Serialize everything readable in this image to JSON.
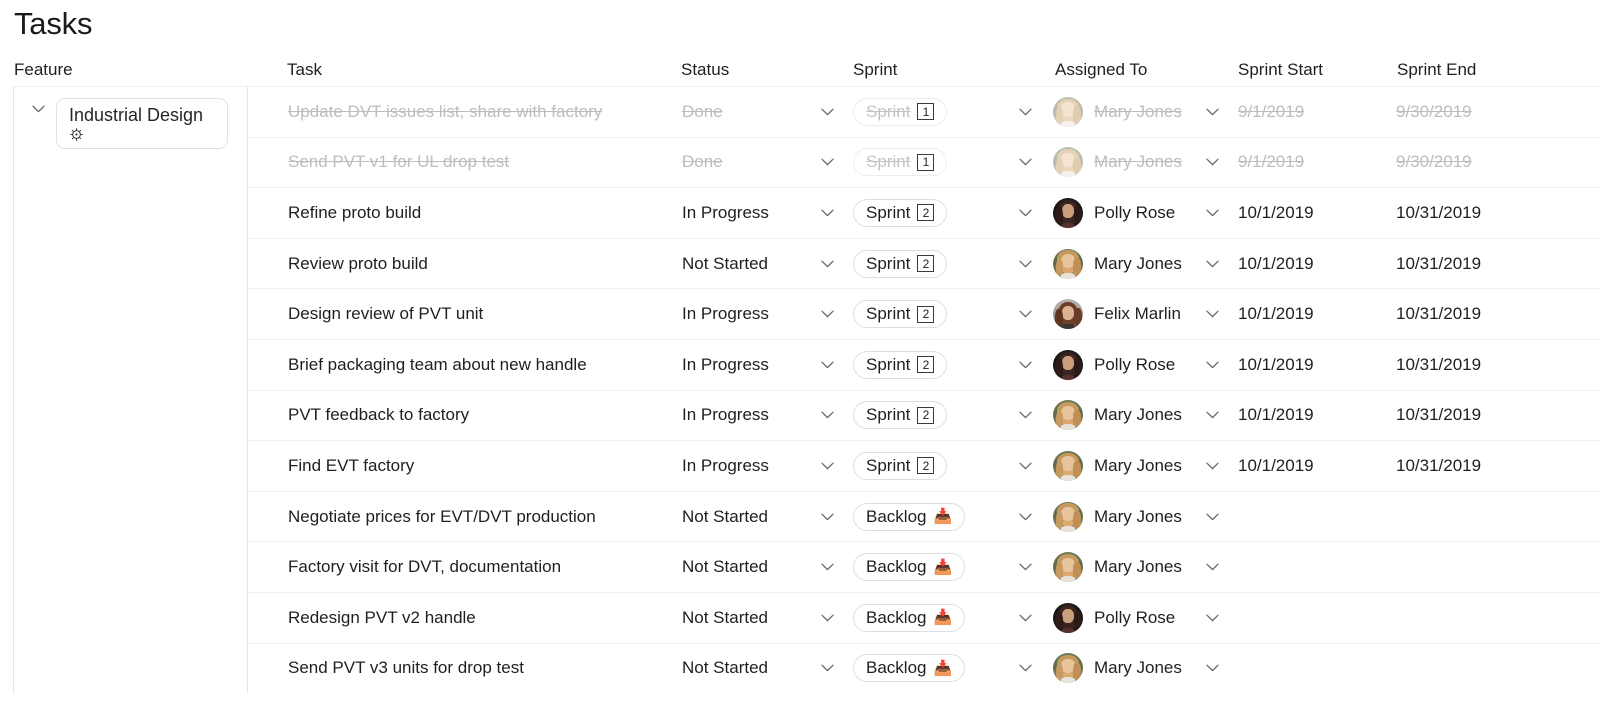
{
  "page": {
    "title": "Tasks"
  },
  "columns": [
    {
      "key": "feature",
      "label": "Feature"
    },
    {
      "key": "task",
      "label": "Task"
    },
    {
      "key": "status",
      "label": "Status"
    },
    {
      "key": "sprint",
      "label": "Sprint"
    },
    {
      "key": "assigned_to",
      "label": "Assigned To"
    },
    {
      "key": "sprint_start",
      "label": "Sprint Start"
    },
    {
      "key": "sprint_end",
      "label": "Sprint End"
    }
  ],
  "feature_group": {
    "label": "Industrial Design",
    "icon": "gear-icon",
    "expand_icon": "chevron-down-icon",
    "expanded": true
  },
  "icons": {
    "dropdown": "chevron-down-icon",
    "backlog": "inbox-tray-icon"
  },
  "rows": [
    {
      "task": "Update DVT issues list, share with factory",
      "status": "Done",
      "sprint": {
        "label": "Sprint",
        "badge": "1",
        "type": "boxed-number"
      },
      "assignee": "Mary Jones",
      "avatar": "mary-jones",
      "sprint_start": "9/1/2019",
      "sprint_end": "9/30/2019",
      "completed": true
    },
    {
      "task": "Send PVT v1 for UL drop test",
      "status": "Done",
      "sprint": {
        "label": "Sprint",
        "badge": "1",
        "type": "boxed-number"
      },
      "assignee": "Mary Jones",
      "avatar": "mary-jones",
      "sprint_start": "9/1/2019",
      "sprint_end": "9/30/2019",
      "completed": true
    },
    {
      "task": "Refine proto build",
      "status": "In Progress",
      "sprint": {
        "label": "Sprint",
        "badge": "2",
        "type": "boxed-number"
      },
      "assignee": "Polly Rose",
      "avatar": "polly-rose",
      "sprint_start": "10/1/2019",
      "sprint_end": "10/31/2019",
      "completed": false
    },
    {
      "task": "Review proto build",
      "status": "Not Started",
      "sprint": {
        "label": "Sprint",
        "badge": "2",
        "type": "boxed-number"
      },
      "assignee": "Mary Jones",
      "avatar": "mary-jones",
      "sprint_start": "10/1/2019",
      "sprint_end": "10/31/2019",
      "completed": false
    },
    {
      "task": "Design review of PVT unit",
      "status": "In Progress",
      "sprint": {
        "label": "Sprint",
        "badge": "2",
        "type": "boxed-number"
      },
      "assignee": "Felix Marlin",
      "avatar": "felix-marlin",
      "sprint_start": "10/1/2019",
      "sprint_end": "10/31/2019",
      "completed": false
    },
    {
      "task": "Brief packaging team about new handle",
      "status": "In Progress",
      "sprint": {
        "label": "Sprint",
        "badge": "2",
        "type": "boxed-number"
      },
      "assignee": "Polly Rose",
      "avatar": "polly-rose",
      "sprint_start": "10/1/2019",
      "sprint_end": "10/31/2019",
      "completed": false
    },
    {
      "task": "PVT feedback to factory",
      "status": "In Progress",
      "sprint": {
        "label": "Sprint",
        "badge": "2",
        "type": "boxed-number"
      },
      "assignee": "Mary Jones",
      "avatar": "mary-jones",
      "sprint_start": "10/1/2019",
      "sprint_end": "10/31/2019",
      "completed": false
    },
    {
      "task": "Find EVT factory",
      "status": "In Progress",
      "sprint": {
        "label": "Sprint",
        "badge": "2",
        "type": "boxed-number"
      },
      "assignee": "Mary Jones",
      "avatar": "mary-jones",
      "sprint_start": "10/1/2019",
      "sprint_end": "10/31/2019",
      "completed": false
    },
    {
      "task": "Negotiate prices for EVT/DVT production",
      "status": "Not Started",
      "sprint": {
        "label": "Backlog",
        "badge": "📥",
        "type": "emoji"
      },
      "assignee": "Mary Jones",
      "avatar": "mary-jones",
      "sprint_start": "",
      "sprint_end": "",
      "completed": false
    },
    {
      "task": "Factory visit for DVT, documentation",
      "status": "Not Started",
      "sprint": {
        "label": "Backlog",
        "badge": "📥",
        "type": "emoji"
      },
      "assignee": "Mary Jones",
      "avatar": "mary-jones",
      "sprint_start": "",
      "sprint_end": "",
      "completed": false
    },
    {
      "task": "Redesign PVT v2 handle",
      "status": "Not Started",
      "sprint": {
        "label": "Backlog",
        "badge": "📥",
        "type": "emoji"
      },
      "assignee": "Polly Rose",
      "avatar": "polly-rose",
      "sprint_start": "",
      "sprint_end": "",
      "completed": false
    },
    {
      "task": "Send PVT v3 units for drop test",
      "status": "Not Started",
      "sprint": {
        "label": "Backlog",
        "badge": "📥",
        "type": "emoji"
      },
      "assignee": "Mary Jones",
      "avatar": "mary-jones",
      "sprint_start": "",
      "sprint_end": "",
      "completed": false
    }
  ],
  "colors": {
    "text": "#201f1e",
    "muted": "#bdbdbd",
    "border": "#efefef",
    "divider": "#e6e6e6",
    "background": "#ffffff"
  }
}
